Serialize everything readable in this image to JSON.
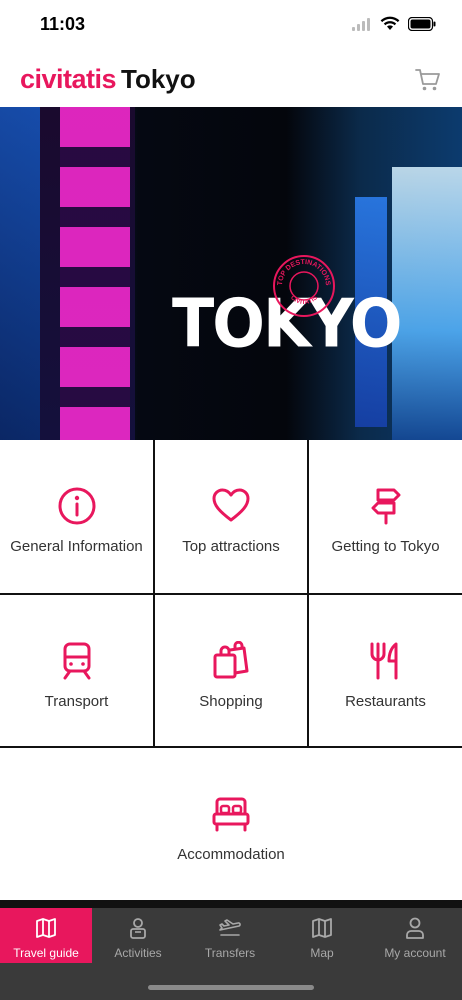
{
  "status_bar": {
    "time": "11:03"
  },
  "header": {
    "brand": "civitatis",
    "city": "Tokyo"
  },
  "hero": {
    "title": "TOKYO",
    "stamp_top": "TOP DESTINATIONS",
    "stamp_bottom": "CIVITATIS"
  },
  "tiles": [
    {
      "label": "General Information",
      "icon": "info-icon"
    },
    {
      "label": "Top attractions",
      "icon": "heart-icon"
    },
    {
      "label": "Getting to Tokyo",
      "icon": "signpost-icon"
    },
    {
      "label": "Transport",
      "icon": "train-icon"
    },
    {
      "label": "Shopping",
      "icon": "shopping-bags-icon"
    },
    {
      "label": "Restaurants",
      "icon": "fork-knife-icon"
    },
    {
      "label": "Accommodation",
      "icon": "bed-icon"
    }
  ],
  "tabbar": {
    "items": [
      {
        "label": "Travel guide",
        "icon": "map-book-icon",
        "active": true
      },
      {
        "label": "Activities",
        "icon": "person-ticket-icon",
        "active": false
      },
      {
        "label": "Transfers",
        "icon": "plane-icon",
        "active": false
      },
      {
        "label": "Map",
        "icon": "map-icon",
        "active": false
      },
      {
        "label": "My account",
        "icon": "user-icon",
        "active": false
      }
    ]
  },
  "colors": {
    "accent": "#e8175d",
    "tabbar_bg": "#3a3a3a",
    "tab_inactive": "#a8a8a8"
  }
}
